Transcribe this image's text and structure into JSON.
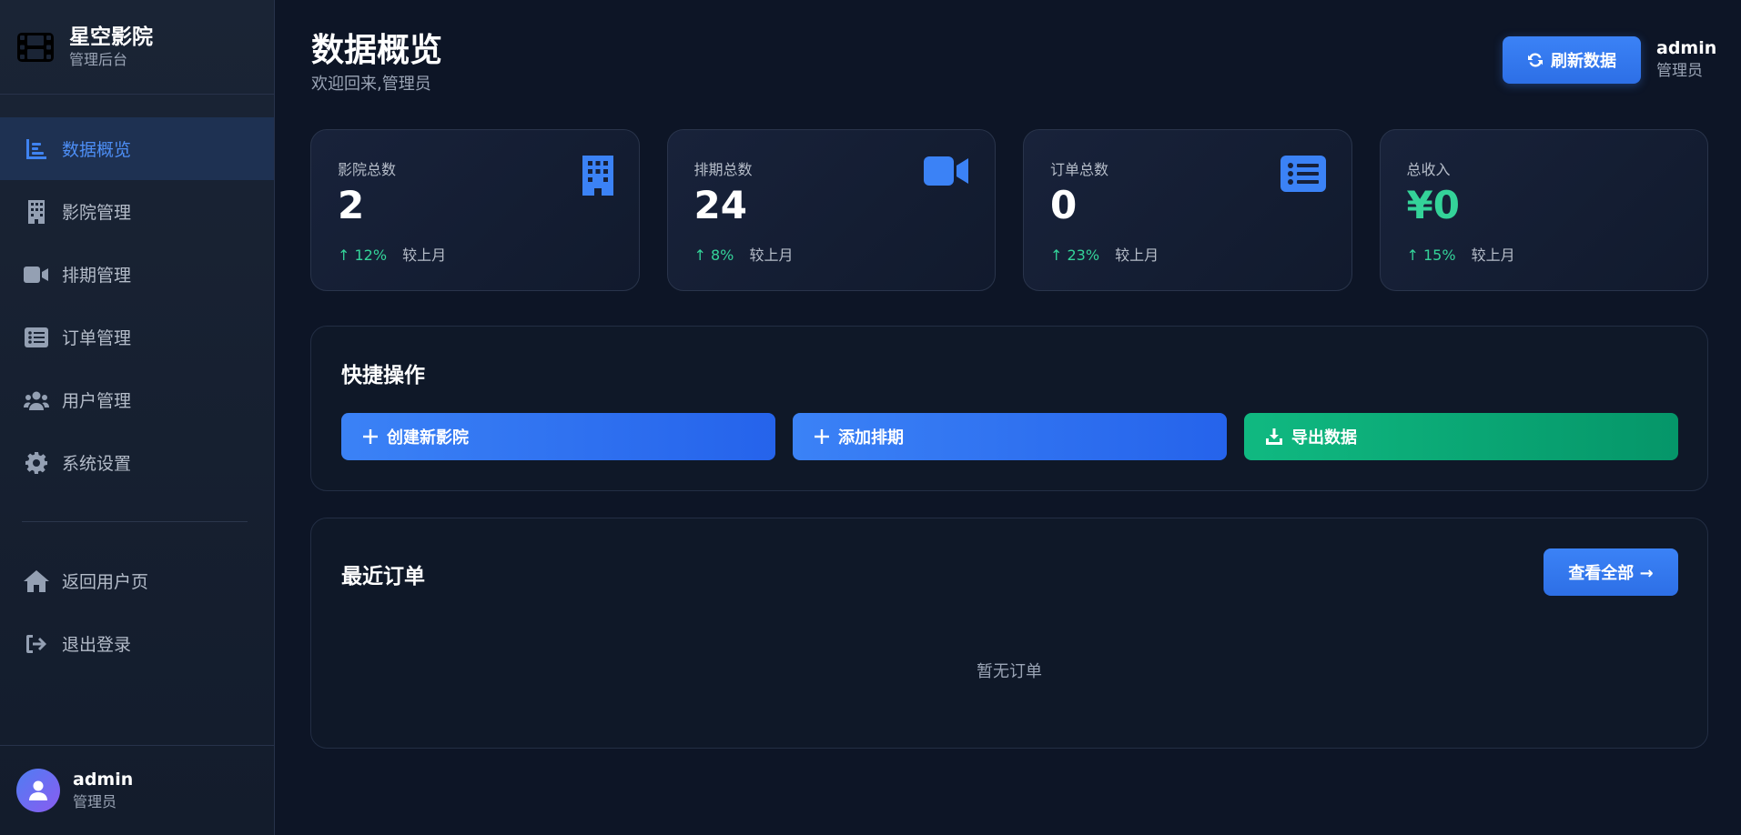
{
  "brand": {
    "title": "星空影院",
    "subtitle": "管理后台",
    "logo_icon": "film-icon"
  },
  "sidebar": {
    "items": [
      {
        "label": "数据概览",
        "icon": "chart-bar-icon",
        "active": true
      },
      {
        "label": "影院管理",
        "icon": "building-icon"
      },
      {
        "label": "排期管理",
        "icon": "video-camera-icon"
      },
      {
        "label": "订单管理",
        "icon": "list-icon"
      },
      {
        "label": "用户管理",
        "icon": "users-icon"
      },
      {
        "label": "系统设置",
        "icon": "gear-icon"
      }
    ],
    "secondary": [
      {
        "label": "返回用户页",
        "icon": "home-icon"
      },
      {
        "label": "退出登录",
        "icon": "logout-icon"
      }
    ],
    "user": {
      "name": "admin",
      "role": "管理员"
    }
  },
  "header": {
    "title": "数据概览",
    "subtitle": "欢迎回来,管理员",
    "refresh_label": "刷新数据",
    "user": {
      "name": "admin",
      "role": "管理员"
    }
  },
  "stats": [
    {
      "label": "影院总数",
      "value": "2",
      "trend": "↑ 12%",
      "note": "较上月",
      "icon": "building-icon"
    },
    {
      "label": "排期总数",
      "value": "24",
      "trend": "↑ 8%",
      "note": "较上月",
      "icon": "video-camera-icon"
    },
    {
      "label": "订单总数",
      "value": "0",
      "trend": "↑ 23%",
      "note": "较上月",
      "icon": "list-icon"
    },
    {
      "label": "总收入",
      "value": "¥0",
      "trend": "↑ 15%",
      "note": "较上月"
    }
  ],
  "quick_actions": {
    "title": "快捷操作",
    "buttons": [
      {
        "label": "创建新影院",
        "icon": "plus-icon"
      },
      {
        "label": "添加排期",
        "icon": "plus-icon"
      },
      {
        "label": "导出数据",
        "icon": "download-icon"
      }
    ]
  },
  "recent_orders": {
    "title": "最近订单",
    "view_all_label": "查看全部 →",
    "empty_text": "暂无订单"
  },
  "colors": {
    "accent": "#3b82f6",
    "success": "#10b981",
    "background": "#0d1526",
    "sidebar": "#1a2435"
  }
}
